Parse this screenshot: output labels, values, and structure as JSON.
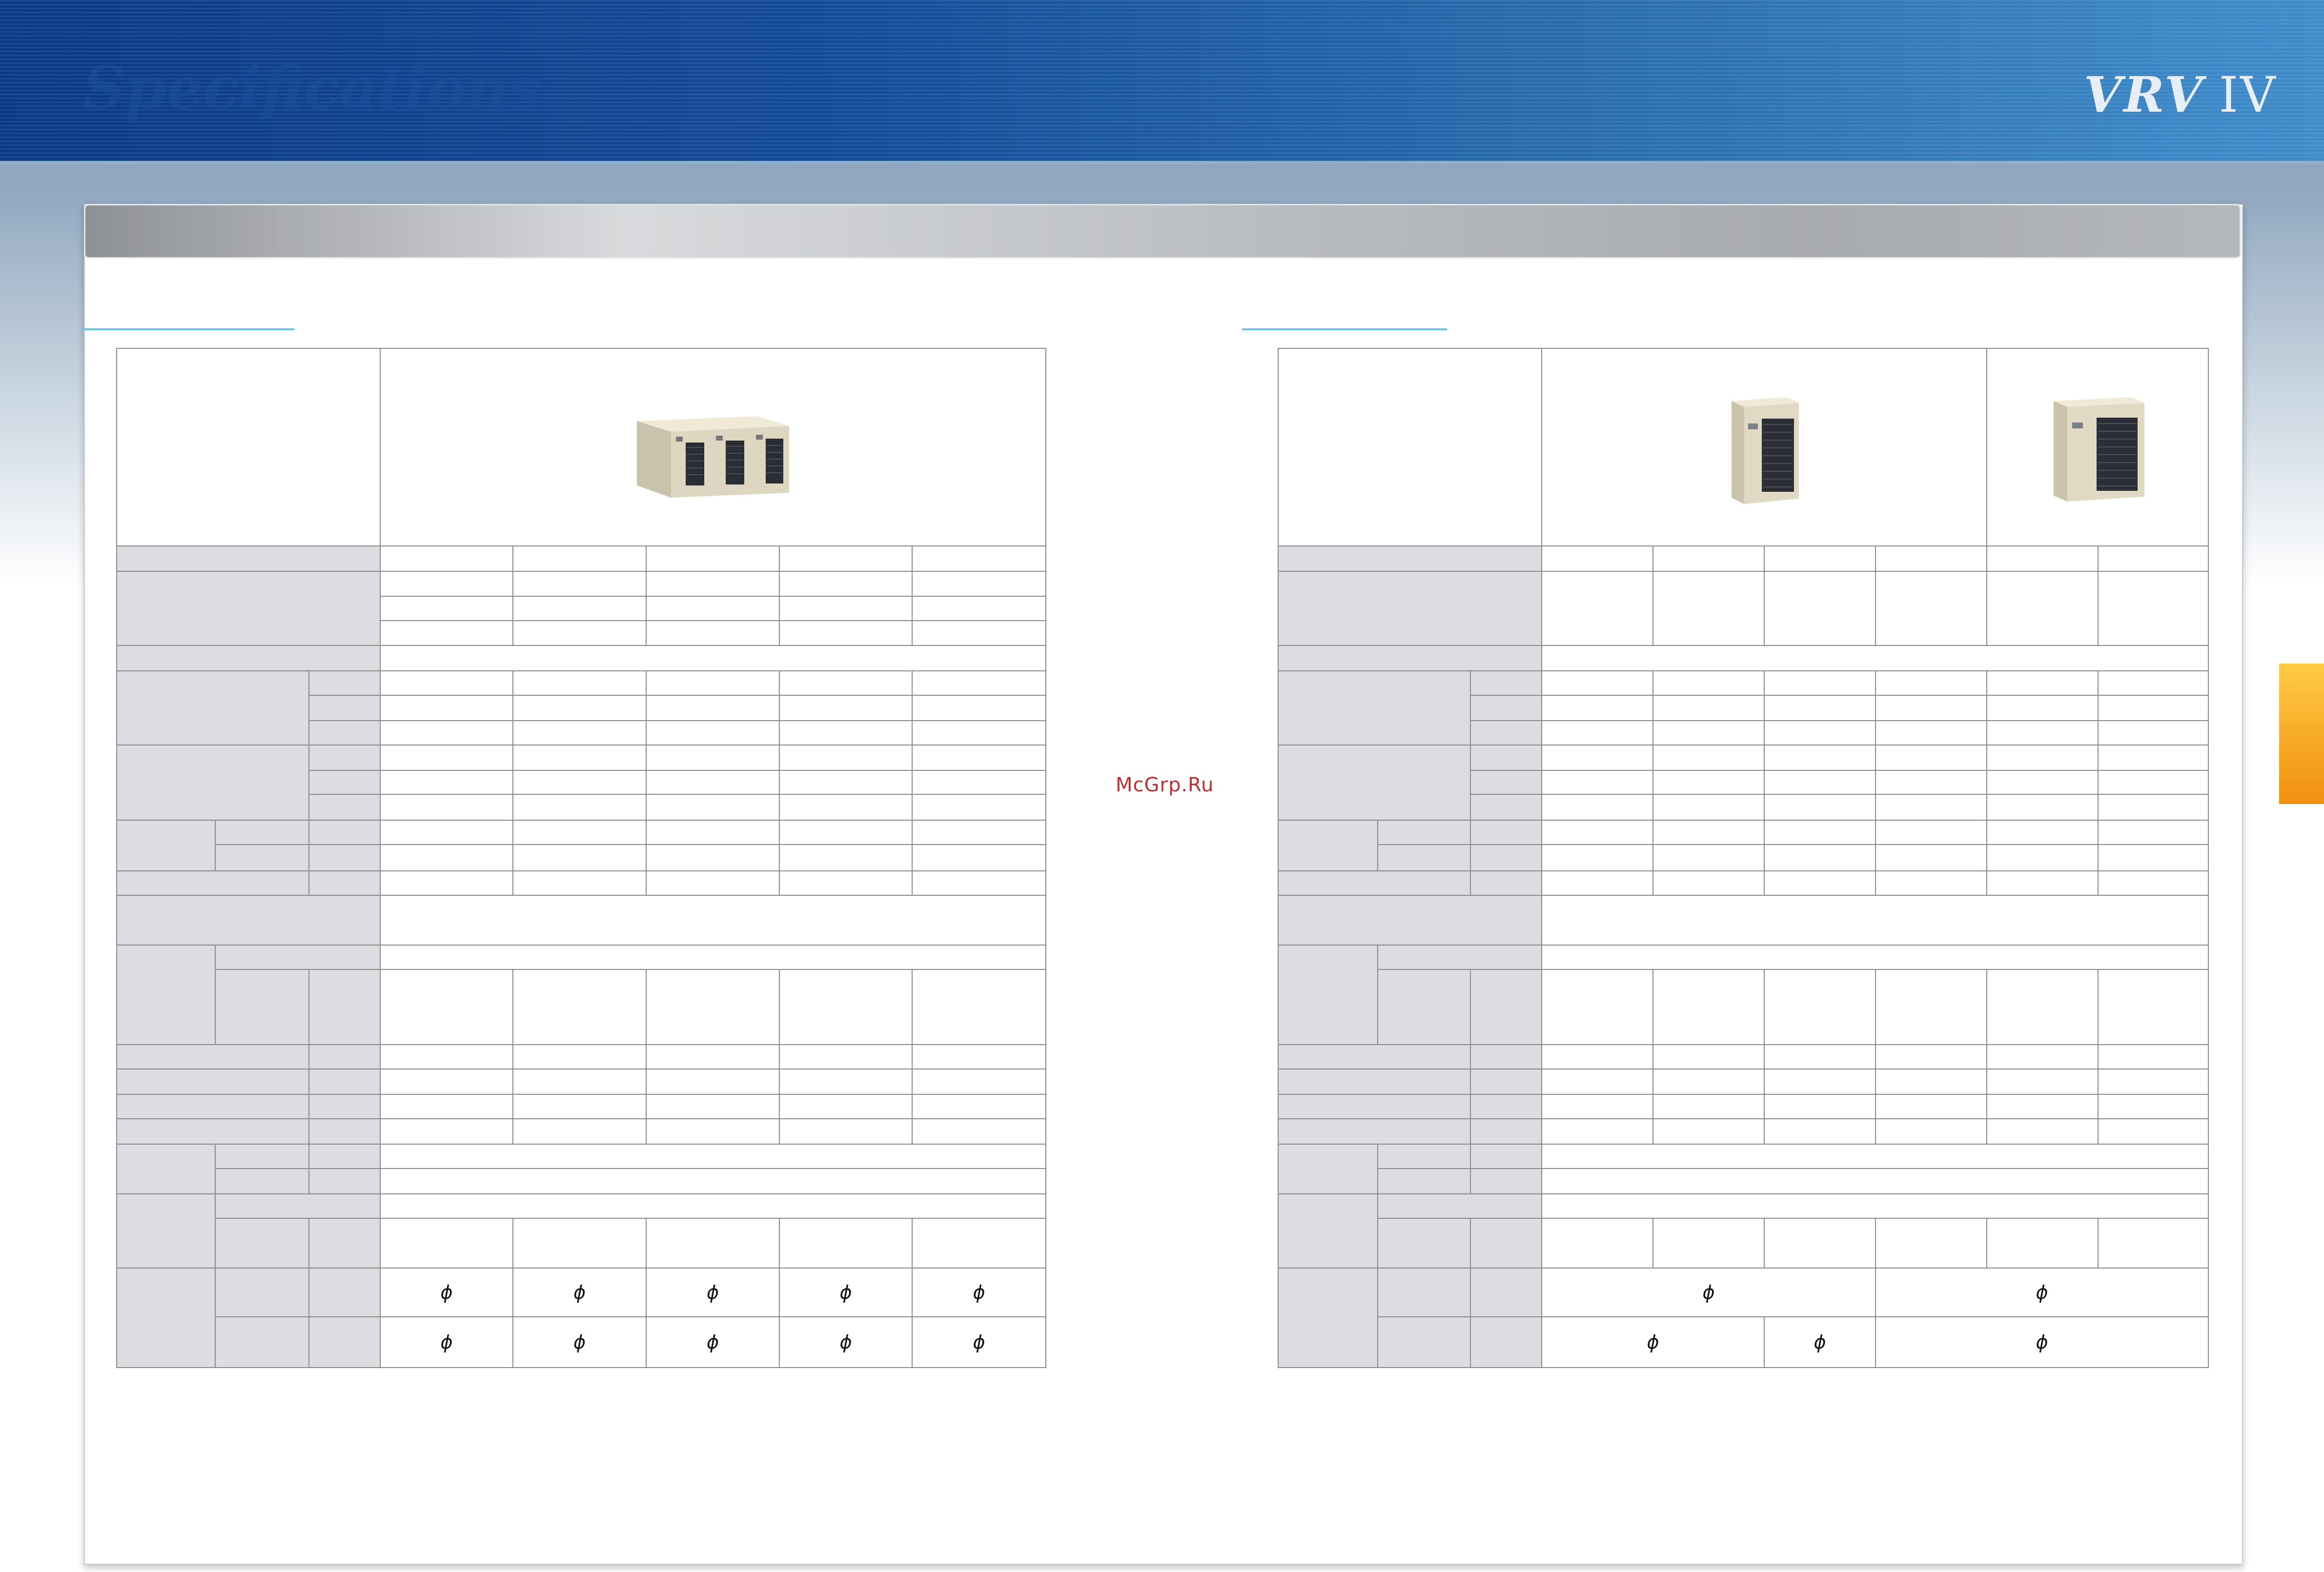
{
  "header": {
    "title": "Specifications",
    "logo": "VRV",
    "logo_numeral": "IV"
  },
  "watermark": "McGrp.Ru",
  "left_table": {
    "phi_symbols": [
      "ϕ",
      "ϕ",
      "ϕ",
      "ϕ",
      "ϕ",
      "ϕ",
      "ϕ",
      "ϕ",
      "ϕ",
      "ϕ"
    ]
  },
  "right_table": {
    "phi_symbols": [
      "ϕ",
      "ϕ",
      "ϕ",
      "ϕ",
      "ϕ"
    ]
  },
  "colors": {
    "label_gray": "#dcdde0",
    "grid": "#8a8a8a",
    "accent_cyan": "#66c6df",
    "header_blue": "#0b3a86",
    "side_tab_orange": "#f39c12"
  }
}
